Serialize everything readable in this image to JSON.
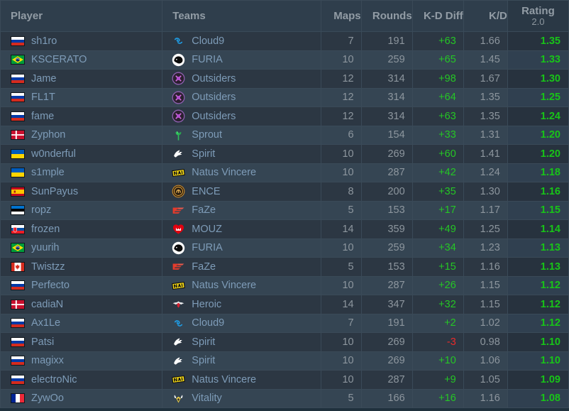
{
  "table": {
    "columns": [
      {
        "key": "player",
        "label": "Player",
        "align": "left"
      },
      {
        "key": "teams",
        "label": "Teams",
        "align": "left"
      },
      {
        "key": "maps",
        "label": "Maps",
        "align": "right"
      },
      {
        "key": "rounds",
        "label": "Rounds",
        "align": "right"
      },
      {
        "key": "kd_diff",
        "label": "K-D Diff",
        "align": "right"
      },
      {
        "key": "kd",
        "label": "K/D",
        "align": "right"
      },
      {
        "key": "rating",
        "label": "Rating",
        "sublabel": "2.0",
        "align": "center"
      }
    ],
    "colors": {
      "positive": "#25c625",
      "negative": "#e92a2a",
      "rating": "#18c418",
      "text": "#8d969e",
      "link": "#7e9cb8",
      "header_bg": "#2f3e4c",
      "row_odd": "#2c3743",
      "row_even": "#354553",
      "border": "#3a4a58"
    },
    "rows": [
      {
        "player": "sh1ro",
        "flag": "ru",
        "team": "Cloud9",
        "logo": "cloud9",
        "maps": "7",
        "rounds": "191",
        "kd_diff": "+63",
        "kd": "1.66",
        "rating": "1.35"
      },
      {
        "player": "KSCERATO",
        "flag": "br",
        "team": "FURIA",
        "logo": "furia",
        "maps": "10",
        "rounds": "259",
        "kd_diff": "+65",
        "kd": "1.45",
        "rating": "1.33"
      },
      {
        "player": "Jame",
        "flag": "ru",
        "team": "Outsiders",
        "logo": "outsiders",
        "maps": "12",
        "rounds": "314",
        "kd_diff": "+98",
        "kd": "1.67",
        "rating": "1.30"
      },
      {
        "player": "FL1T",
        "flag": "ru",
        "team": "Outsiders",
        "logo": "outsiders",
        "maps": "12",
        "rounds": "314",
        "kd_diff": "+64",
        "kd": "1.35",
        "rating": "1.25"
      },
      {
        "player": "fame",
        "flag": "ru",
        "team": "Outsiders",
        "logo": "outsiders",
        "maps": "12",
        "rounds": "314",
        "kd_diff": "+63",
        "kd": "1.35",
        "rating": "1.24"
      },
      {
        "player": "Zyphon",
        "flag": "dk",
        "team": "Sprout",
        "logo": "sprout",
        "maps": "6",
        "rounds": "154",
        "kd_diff": "+33",
        "kd": "1.31",
        "rating": "1.20"
      },
      {
        "player": "w0nderful",
        "flag": "ua",
        "team": "Spirit",
        "logo": "spirit",
        "maps": "10",
        "rounds": "269",
        "kd_diff": "+60",
        "kd": "1.41",
        "rating": "1.20"
      },
      {
        "player": "s1mple",
        "flag": "ua",
        "team": "Natus Vincere",
        "logo": "navi",
        "maps": "10",
        "rounds": "287",
        "kd_diff": "+42",
        "kd": "1.24",
        "rating": "1.18"
      },
      {
        "player": "SunPayus",
        "flag": "es",
        "team": "ENCE",
        "logo": "ence",
        "maps": "8",
        "rounds": "200",
        "kd_diff": "+35",
        "kd": "1.30",
        "rating": "1.16"
      },
      {
        "player": "ropz",
        "flag": "ee",
        "team": "FaZe",
        "logo": "faze",
        "maps": "5",
        "rounds": "153",
        "kd_diff": "+17",
        "kd": "1.17",
        "rating": "1.15"
      },
      {
        "player": "frozen",
        "flag": "sk",
        "team": "MOUZ",
        "logo": "mouz",
        "maps": "14",
        "rounds": "359",
        "kd_diff": "+49",
        "kd": "1.25",
        "rating": "1.14"
      },
      {
        "player": "yuurih",
        "flag": "br",
        "team": "FURIA",
        "logo": "furia",
        "maps": "10",
        "rounds": "259",
        "kd_diff": "+34",
        "kd": "1.23",
        "rating": "1.13"
      },
      {
        "player": "Twistzz",
        "flag": "ca",
        "team": "FaZe",
        "logo": "faze",
        "maps": "5",
        "rounds": "153",
        "kd_diff": "+15",
        "kd": "1.16",
        "rating": "1.13"
      },
      {
        "player": "Perfecto",
        "flag": "ru",
        "team": "Natus Vincere",
        "logo": "navi",
        "maps": "10",
        "rounds": "287",
        "kd_diff": "+26",
        "kd": "1.15",
        "rating": "1.12"
      },
      {
        "player": "cadiaN",
        "flag": "dk",
        "team": "Heroic",
        "logo": "heroic",
        "maps": "14",
        "rounds": "347",
        "kd_diff": "+32",
        "kd": "1.15",
        "rating": "1.12"
      },
      {
        "player": "Ax1Le",
        "flag": "ru",
        "team": "Cloud9",
        "logo": "cloud9",
        "maps": "7",
        "rounds": "191",
        "kd_diff": "+2",
        "kd": "1.02",
        "rating": "1.12"
      },
      {
        "player": "Patsi",
        "flag": "ru",
        "team": "Spirit",
        "logo": "spirit",
        "maps": "10",
        "rounds": "269",
        "kd_diff": "-3",
        "kd": "0.98",
        "rating": "1.10"
      },
      {
        "player": "magixx",
        "flag": "ru",
        "team": "Spirit",
        "logo": "spirit",
        "maps": "10",
        "rounds": "269",
        "kd_diff": "+10",
        "kd": "1.06",
        "rating": "1.10"
      },
      {
        "player": "electroNic",
        "flag": "ru",
        "team": "Natus Vincere",
        "logo": "navi",
        "maps": "10",
        "rounds": "287",
        "kd_diff": "+9",
        "kd": "1.05",
        "rating": "1.09"
      },
      {
        "player": "ZywOo",
        "flag": "fr",
        "team": "Vitality",
        "logo": "vitality",
        "maps": "5",
        "rounds": "166",
        "kd_diff": "+16",
        "kd": "1.16",
        "rating": "1.08"
      }
    ]
  }
}
